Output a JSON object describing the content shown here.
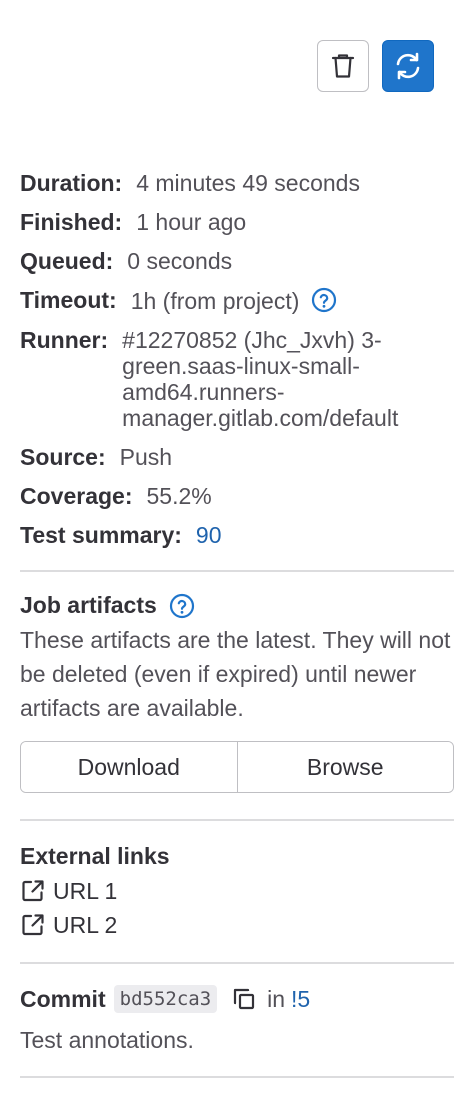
{
  "info": [
    {
      "key": "Duration:",
      "value": "4 minutes 49 seconds"
    },
    {
      "key": "Finished:",
      "value": "1 hour ago"
    },
    {
      "key": "Queued:",
      "value": "0 seconds"
    },
    {
      "key": "Timeout:",
      "value": "1h (from project)"
    },
    {
      "key": "Runner:",
      "value": "#12270852 (Jhc_Jxvh) 3-green.saas-linux-small-amd64.runners-manager.gitlab.com/default"
    },
    {
      "key": "Source:",
      "value": "Push"
    },
    {
      "key": "Coverage:",
      "value": "55.2%"
    },
    {
      "key": "Test summary:",
      "value": "90"
    }
  ],
  "artifacts": {
    "title": "Job artifacts",
    "description": "These artifacts are the latest. They will not be deleted (even if expired) until newer artifacts are available.",
    "download_label": "Download",
    "browse_label": "Browse"
  },
  "external_links": {
    "title": "External links",
    "links": [
      "URL 1",
      "URL 2"
    ]
  },
  "commit": {
    "label": "Commit",
    "sha": "bd552ca3",
    "in_text": "in",
    "mr": "!5",
    "message": "Test annotations."
  },
  "colors": {
    "primary": "#1f75cb",
    "link": "#1f63ad"
  },
  "icons": [
    "trash-icon",
    "retry-icon",
    "question-icon",
    "external-link-icon",
    "copy-icon"
  ]
}
